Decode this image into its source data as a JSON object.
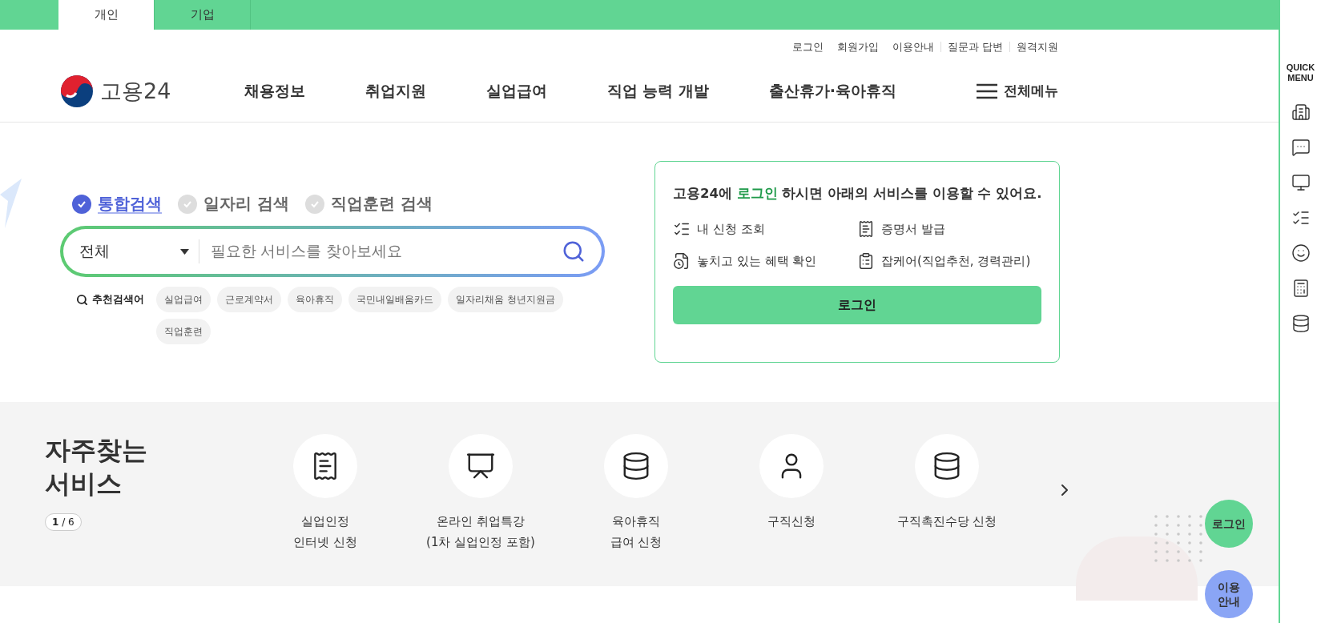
{
  "audience_tabs": [
    {
      "label": "개인",
      "selected": true
    },
    {
      "label": "기업",
      "selected": false
    }
  ],
  "utility_links": [
    {
      "label": "로그인",
      "divider": false
    },
    {
      "label": "회원가입",
      "divider": false
    },
    {
      "label": "이용안내",
      "divider": false
    },
    {
      "label": "질문과 답변",
      "divider": true
    },
    {
      "label": "원격지원",
      "divider": true
    }
  ],
  "logo": {
    "text": "고용24"
  },
  "nav": [
    "채용정보",
    "취업지원",
    "실업급여",
    "직업 능력 개발",
    "출산휴가·육아휴직"
  ],
  "all_menu": "전체메뉴",
  "search": {
    "tabs": [
      {
        "label": "통합검색",
        "selected": true
      },
      {
        "label": "일자리 검색",
        "selected": false
      },
      {
        "label": "직업훈련 검색",
        "selected": false
      }
    ],
    "category": "전체",
    "placeholder": "필요한 서비스를 찾아보세요",
    "recommend_label": "추천검색어",
    "keywords": [
      "실업급여",
      "근로계약서",
      "육아휴직",
      "국민내일배움카드",
      "일자리채움 청년지원금",
      "직업훈련"
    ]
  },
  "login_card": {
    "message_before": "고용24에 ",
    "message_highlight": "로그인",
    "message_after": " 하시면 아래의 서비스를 이용할 수 있어요.",
    "services": [
      "내 신청 조회",
      "증명서 발급",
      "놓치고 있는 혜택 확인",
      "잡케어(직업추천, 경력관리)"
    ],
    "button": "로그인"
  },
  "frequent": {
    "title": "자주찾는\n서비스",
    "pager": "**1** / 6",
    "services": [
      "실업인정\n인터넷 신청",
      "온라인 취업특강\n(1차 실업인정 포함)",
      "육아휴직\n급여 신청",
      "구직신청",
      "구직촉진수당 신청"
    ]
  },
  "floating_buttons": [
    {
      "label": "로그인",
      "color": "#61d593"
    },
    {
      "label": "이용\n안내",
      "color": "#8aa5f5"
    }
  ],
  "quick_menu": {
    "title": "QUICK\nMENU"
  }
}
